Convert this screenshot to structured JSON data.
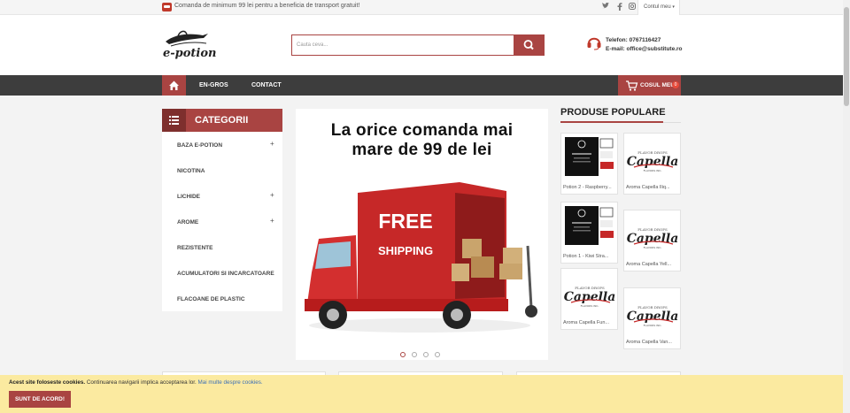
{
  "topbar": {
    "notice": "Comanda de minimum 99 lei pentru a beneficia de transport gratuit!",
    "social": [
      "twitter-icon",
      "facebook-icon",
      "instagram-icon"
    ],
    "account": "Contul meu"
  },
  "header": {
    "logo_text": "e-potion",
    "search_placeholder": "Cauta ceva...",
    "phone": "Telefon: 0767116427",
    "email": "E-mail: office@substitute.ro"
  },
  "nav": {
    "items": [
      "EN-GROS",
      "CONTACT"
    ],
    "cart_label": "COSUL MEU",
    "cart_count": "0"
  },
  "categories": {
    "title": "CATEGORII",
    "items": [
      {
        "label": "BAZA E-POTION",
        "expandable": true
      },
      {
        "label": "NICOTINA",
        "expandable": false
      },
      {
        "label": "LICHIDE",
        "expandable": true
      },
      {
        "label": "AROME",
        "expandable": true
      },
      {
        "label": "REZISTENTE",
        "expandable": false
      },
      {
        "label": "ACUMULATORI SI INCARCATOARE",
        "expandable": false
      },
      {
        "label": "FLACOANE DE PLASTIC",
        "expandable": false
      }
    ]
  },
  "banner": {
    "line1": "La orice comanda mai",
    "line2": "mare de 99 de lei",
    "truck_text1": "FREE",
    "truck_text2": "SHIPPING",
    "slides": 4,
    "active_slide": 1
  },
  "popular": {
    "title": "PRODUSE POPULARE",
    "products": [
      {
        "name": "Potion 2 - Raspberry...",
        "image": "potion"
      },
      {
        "name": "Aroma Capella Iliq...",
        "image": "capella"
      },
      {
        "name": "Potion 1 - Kiwi Stra...",
        "image": "potion"
      },
      {
        "name": "Aroma Capella Yell...",
        "image": "capella"
      },
      {
        "name": "Aroma Capella Fun...",
        "image": "capella"
      },
      {
        "name": "Aroma Capella Van...",
        "image": "capella"
      }
    ]
  },
  "cookie": {
    "bold": "Acest site foloseste cookies.",
    "text": "Continuarea navigarii implica acceptarea lor.",
    "link": "Mai multe despre cookies.",
    "button": "SUNT DE ACORD!"
  },
  "colors": {
    "accent": "#a94442",
    "nav_bg": "#3d3d3d",
    "cookie_bg": "#fbeaa0"
  }
}
